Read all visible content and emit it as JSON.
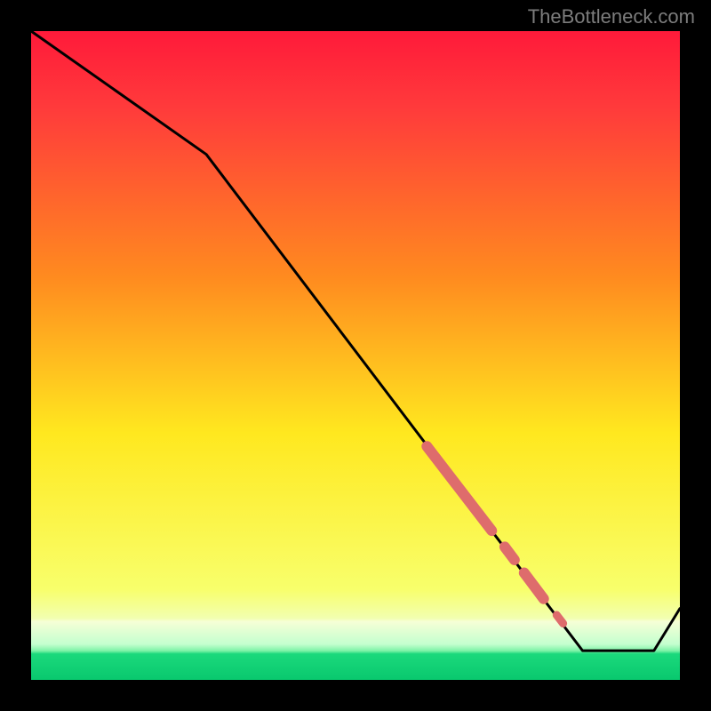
{
  "watermark": "TheBottleneck.com",
  "chart_data": {
    "type": "line",
    "title": "",
    "xlabel": "",
    "ylabel": "",
    "xlim": [
      0,
      100
    ],
    "ylim": [
      0,
      100
    ],
    "line": {
      "x": [
        0,
        27,
        85,
        96,
        100
      ],
      "y": [
        100,
        81,
        4.5,
        4.5,
        11
      ]
    },
    "highlight_segments": [
      {
        "x1": 61,
        "y1": 36,
        "x2": 71,
        "y2": 23,
        "thick": true
      },
      {
        "x1": 73,
        "y1": 20.5,
        "x2": 74.5,
        "y2": 18.5,
        "thick": true
      },
      {
        "x1": 76,
        "y1": 16.5,
        "x2": 79,
        "y2": 12.5,
        "thick": true
      },
      {
        "x1": 81,
        "y1": 10,
        "x2": 82,
        "y2": 8.7,
        "thick": false
      }
    ],
    "background_gradient": {
      "top": "#ff1a3a",
      "mid1": "#ff8b1f",
      "mid2": "#ffe81f",
      "mid3": "#f8ff6b",
      "bottom_band_light": "#d3ffb5",
      "bottom_band_green": "#1bd97c",
      "transition_band_y_range": [
        2,
        10
      ]
    },
    "colors": {
      "line": "#000000",
      "highlight": "#de6c6c",
      "border": "#000000"
    }
  }
}
